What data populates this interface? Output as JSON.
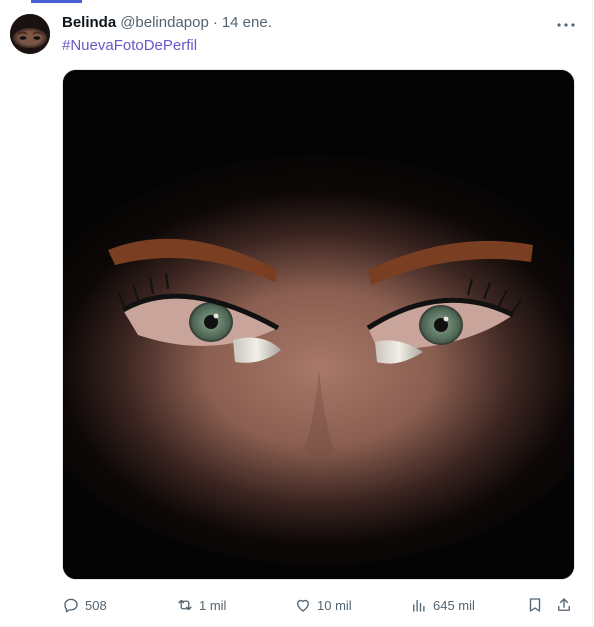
{
  "post": {
    "author_name": "Belinda",
    "handle": "@belindapop",
    "separator": "·",
    "date": "14 ene.",
    "text": "#NuevaFotoDePerfil",
    "media_description": "close-up of eyes with glitter eyeshadow, vignette on black"
  },
  "actions": {
    "replies": "508",
    "reposts": "1 mil",
    "likes": "10 mil",
    "views": "645 mil"
  },
  "icons": {
    "more": "more-horizontal-icon",
    "reply": "reply-icon",
    "repost": "repost-icon",
    "like": "heart-icon",
    "views": "views-chart-icon",
    "bookmark": "bookmark-icon",
    "share": "share-icon"
  },
  "colors": {
    "hashtag": "#6b55c8",
    "secondary_text": "#536471",
    "accent": "#4a5fd6"
  }
}
